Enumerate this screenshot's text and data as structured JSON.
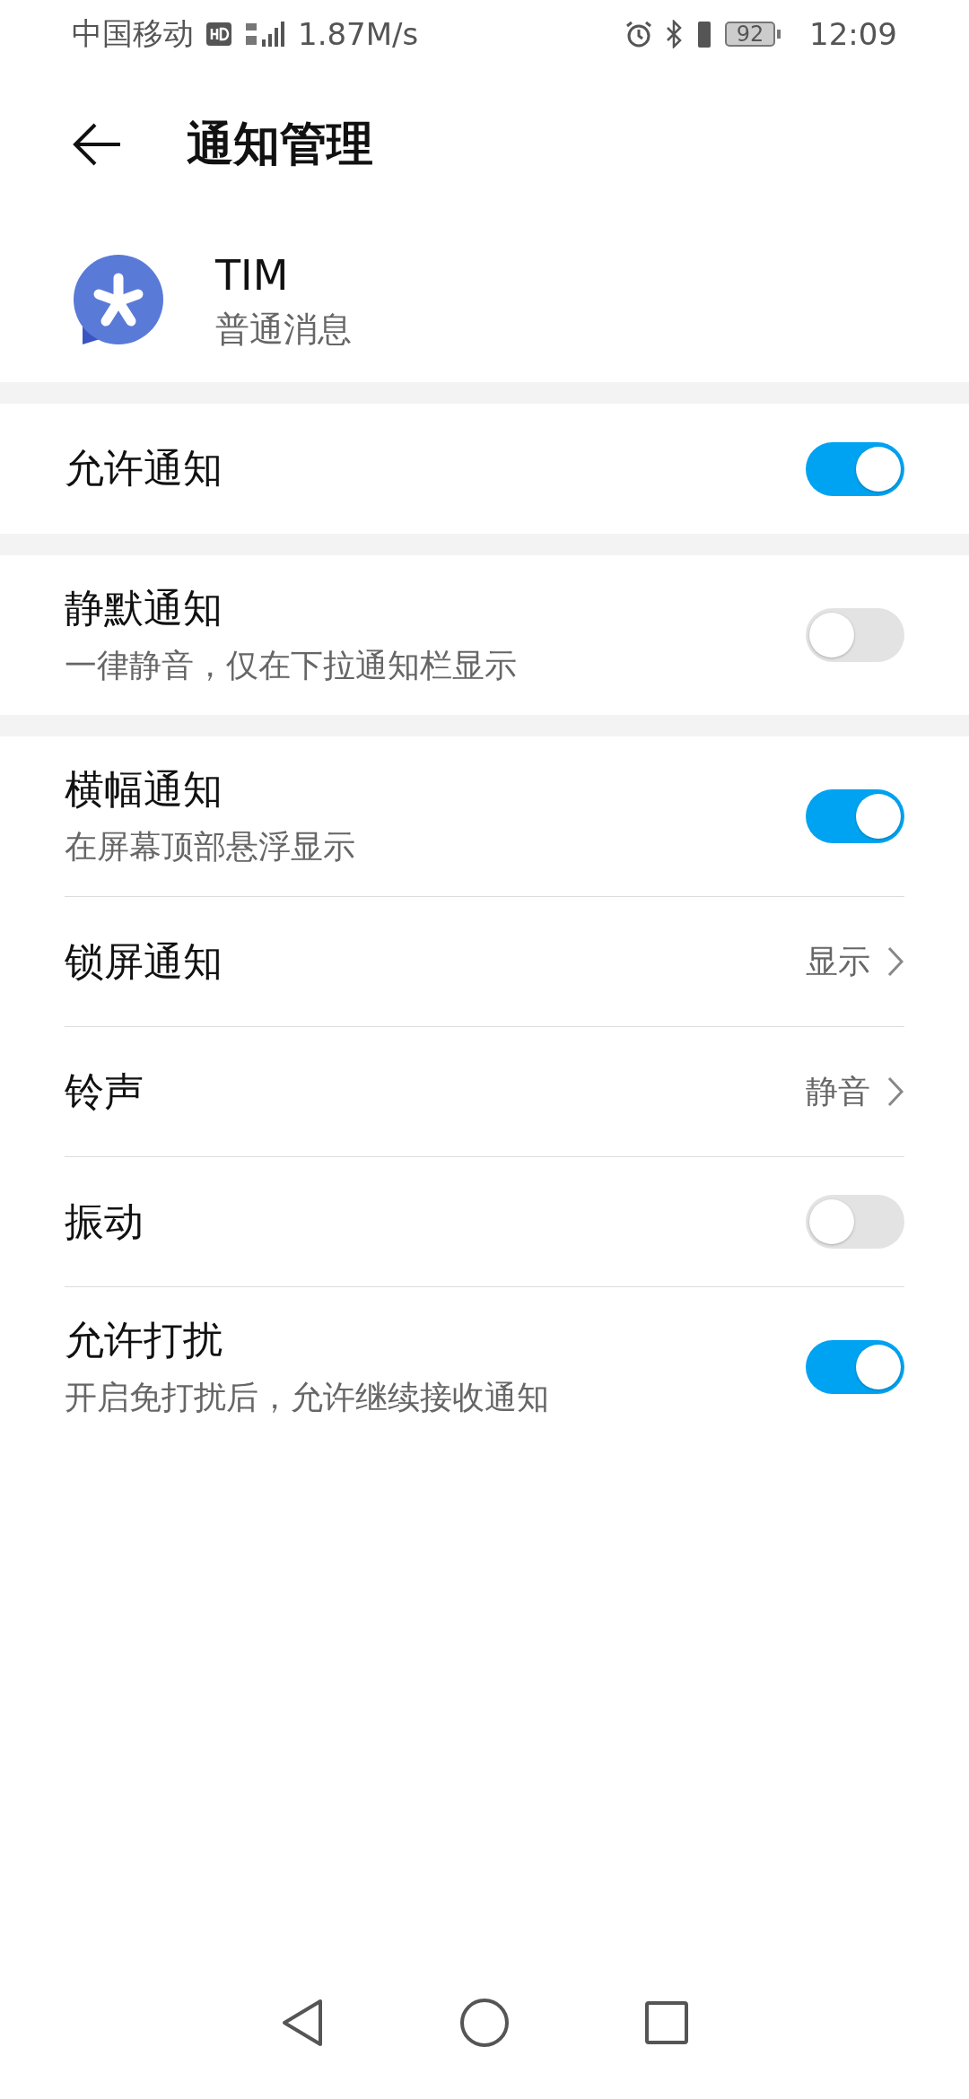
{
  "status_bar": {
    "carrier": "中国移动",
    "speed": "1.87M/s",
    "battery": "92",
    "time": "12:09"
  },
  "header": {
    "title": "通知管理"
  },
  "app": {
    "name": "TIM",
    "category": "普通消息"
  },
  "sections": [
    {
      "items": [
        {
          "kind": "toggle",
          "title": "允许通知",
          "on": true
        }
      ]
    },
    {
      "items": [
        {
          "kind": "toggle",
          "title": "静默通知",
          "subtitle": "一律静音，仅在下拉通知栏显示",
          "on": false
        }
      ]
    },
    {
      "items": [
        {
          "kind": "toggle",
          "title": "横幅通知",
          "subtitle": "在屏幕顶部悬浮显示",
          "on": true
        },
        {
          "kind": "value",
          "title": "锁屏通知",
          "value": "显示"
        },
        {
          "kind": "value",
          "title": "铃声",
          "value": "静音"
        },
        {
          "kind": "toggle",
          "title": "振动",
          "on": false
        },
        {
          "kind": "toggle",
          "title": "允许打扰",
          "subtitle": "开启免打扰后，允许继续接收通知",
          "on": true
        }
      ]
    }
  ]
}
